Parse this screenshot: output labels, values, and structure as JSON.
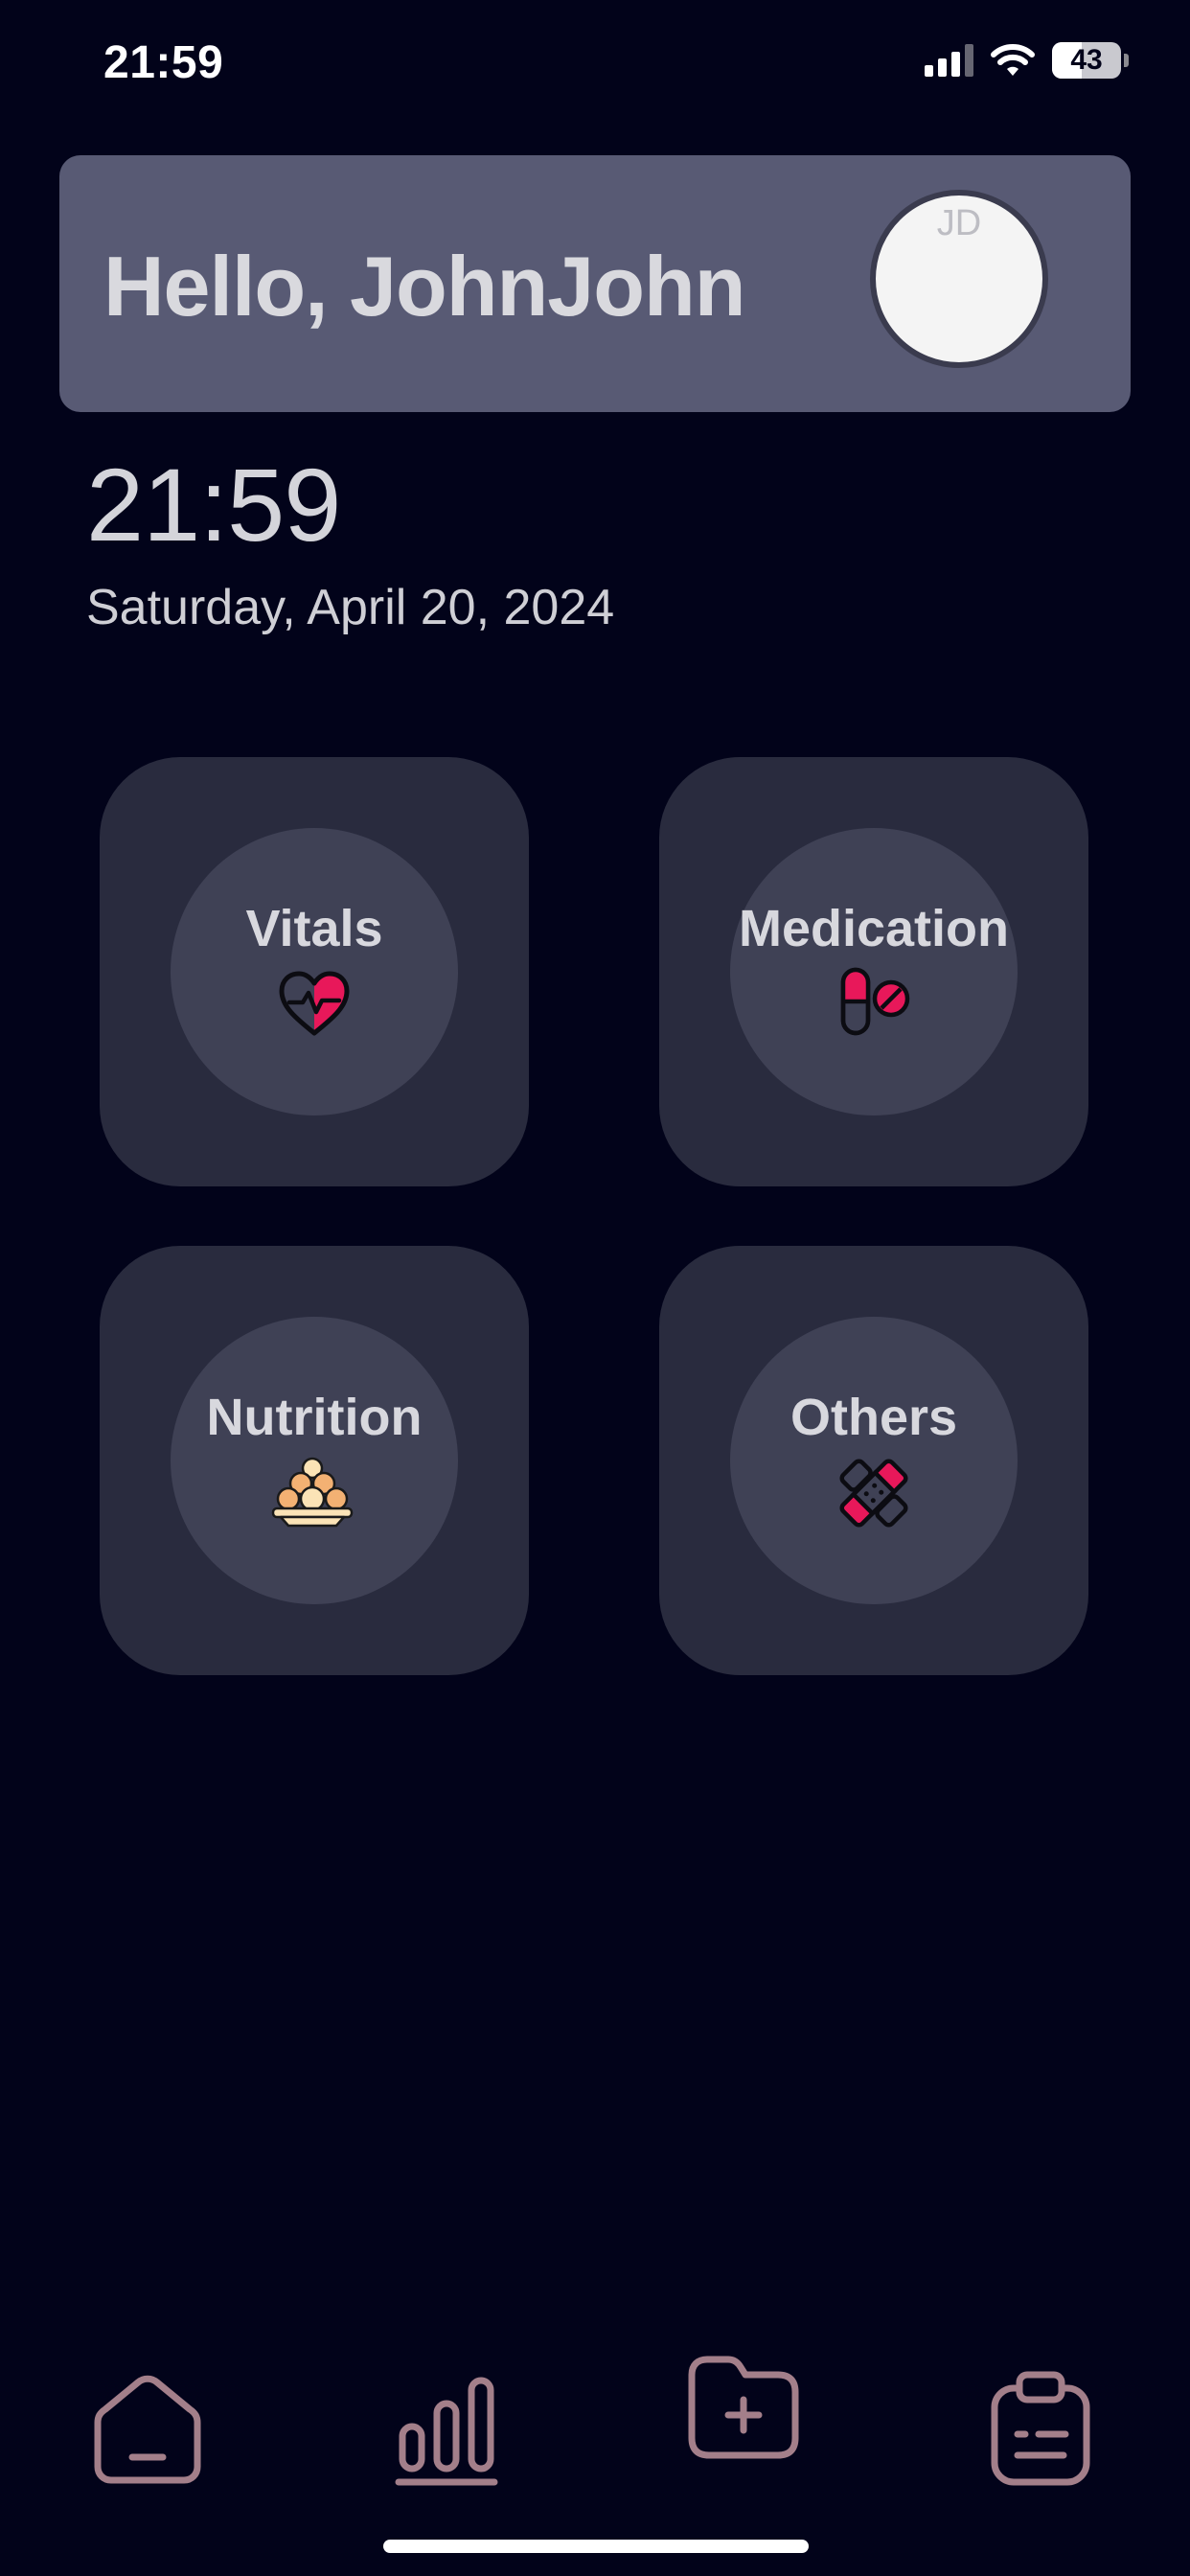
{
  "status_bar": {
    "time": "21:59",
    "battery": "43",
    "battery_level_percent": 43,
    "signal_bars_active": 3,
    "signal_bars_total": 4
  },
  "header": {
    "greeting": "Hello, JohnJohn",
    "avatar_initials": "JD"
  },
  "clock": {
    "time": "21:59",
    "date": "Saturday, April 20, 2024"
  },
  "tiles": [
    {
      "label": "Vitals",
      "icon": "heart-pulse-icon"
    },
    {
      "label": "Medication",
      "icon": "pill-capsule-icon"
    },
    {
      "label": "Nutrition",
      "icon": "food-bowl-icon"
    },
    {
      "label": "Others",
      "icon": "bandage-icon"
    }
  ],
  "bottom_nav": {
    "items": [
      {
        "icon": "home-icon"
      },
      {
        "icon": "bar-chart-icon"
      },
      {
        "icon": "folder-add-icon"
      },
      {
        "icon": "clipboard-icon"
      }
    ]
  },
  "colors": {
    "background": "#02031a",
    "card": "#585a74",
    "tile": "#292b3e",
    "tile_circle": "#3f4155",
    "accent_red": "#e8185a",
    "nav_icon": "#a37f8a"
  }
}
